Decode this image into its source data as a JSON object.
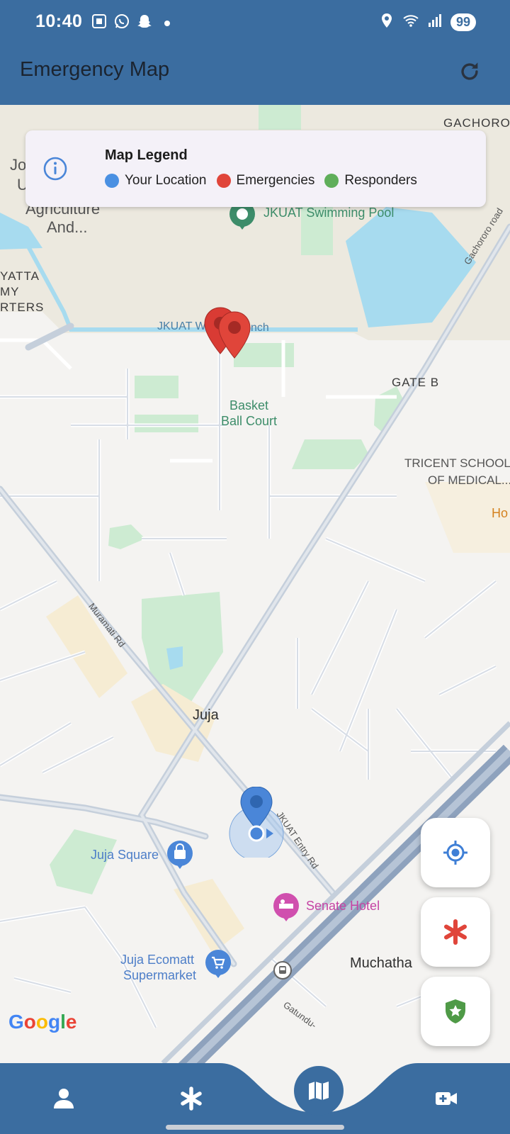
{
  "status_bar": {
    "time": "10:40",
    "battery": "99",
    "left_icons": [
      "screenshot-icon",
      "whatsapp-icon",
      "snapchat-icon",
      "notification-dot"
    ],
    "right_icons": [
      "location-icon",
      "wifi-icon",
      "signal-icon"
    ]
  },
  "app_bar": {
    "title": "Emergency Map",
    "refresh_icon": "refresh-icon",
    "color": "#3b6da0"
  },
  "legend": {
    "title": "Map Legend",
    "icon": "info-icon",
    "items": [
      {
        "label": "Your Location",
        "color": "#4a90e2"
      },
      {
        "label": "Emergencies",
        "color": "#e0453a"
      },
      {
        "label": "Responders",
        "color": "#5fae5a"
      }
    ]
  },
  "map": {
    "labels": {
      "gachoroka": "GACHORO",
      "agriculture_1": "Agriculture",
      "agriculture_2": "And...",
      "jo": "Jo",
      "u": "U",
      "yatta": "YATTA",
      "my": "MY",
      "rters": "RTERS",
      "swimming_pool": "JKUAT Swimming Pool",
      "jkuat_branch": "JKUAT W",
      "jkuat_branch_end": "nch",
      "gachororo_road": "Gachororo road",
      "gate_b": "GATE B",
      "basket_1": "Basket",
      "basket_2": "Ball Court",
      "tricent_1": "TRICENT SCHOOL",
      "tricent_2": "OF MEDICAL...",
      "ho": "Ho",
      "muramati_rd": "Muramati Rd",
      "juja": "Juja",
      "jkuat_entry_rd": "JKUAT Entry Rd",
      "juja_square": "Juja Square",
      "senate_hotel": "Senate Hotel",
      "juja_ecomatt_1": "Juja Ecomatt",
      "juja_ecomatt_2": "Supermarket",
      "muchatha": "Muchatha",
      "gatundu": "Gatundu-",
      "google": "Google"
    },
    "markers": {
      "emergency_count": 2,
      "your_location": "blue-location-pin"
    }
  },
  "fabs": [
    {
      "icon": "my-location-icon",
      "color": "#3f7fd6"
    },
    {
      "icon": "emergency-asterisk-icon",
      "color": "#e0453a"
    },
    {
      "icon": "shield-star-icon",
      "color": "#4f9a47"
    }
  ],
  "bottom_nav": {
    "items": [
      "profile-icon",
      "emergency-icon",
      "map-icon",
      "video-call-icon"
    ],
    "active": "map-icon"
  }
}
